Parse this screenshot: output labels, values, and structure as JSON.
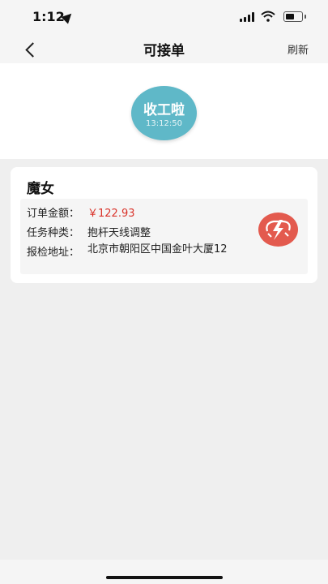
{
  "status_bar": {
    "time": "1:12"
  },
  "nav": {
    "title": "可接单",
    "refresh_label": "刷新"
  },
  "clock": {
    "label": "收工啦",
    "time": "13:12:50",
    "color": "#5fb8c8"
  },
  "order": {
    "title": "魔女",
    "amount_label": "订单金额：",
    "amount_value": "￥122.93",
    "task_type_label": "任务种类：",
    "task_type_value": "抱杆天线调整",
    "address_label": "报检地址：",
    "address_value": "北京市朝阳区中国金叶大厦12",
    "grab_icon": "grab-order-icon",
    "grab_color": "#e35a4e"
  }
}
